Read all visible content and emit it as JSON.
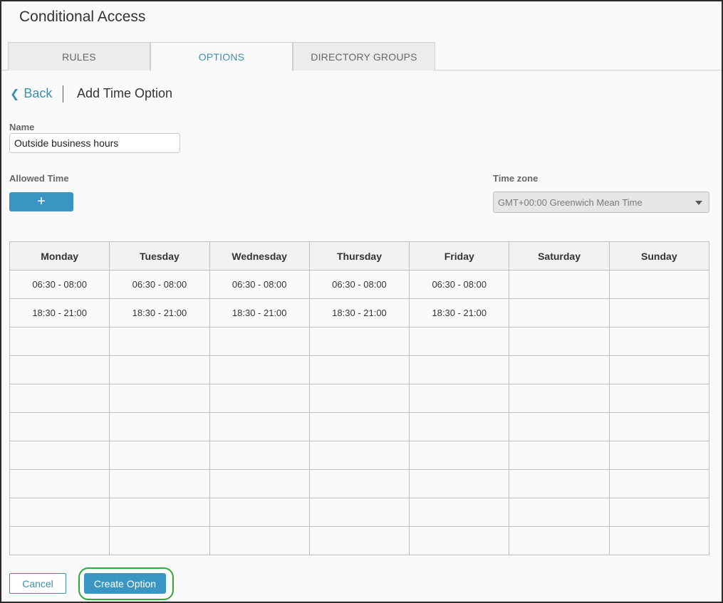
{
  "header": {
    "title": "Conditional Access"
  },
  "tabs": [
    {
      "label": "RULES"
    },
    {
      "label": "OPTIONS"
    },
    {
      "label": "DIRECTORY GROUPS"
    }
  ],
  "nav": {
    "back_label": "Back",
    "page_title": "Add Time Option"
  },
  "form": {
    "name_label": "Name",
    "name_value": "Outside business hours",
    "allowed_time_label": "Allowed Time",
    "add_button_label": "+",
    "timezone_label": "Time zone",
    "timezone_value": "GMT+00:00 Greenwich Mean Time"
  },
  "schedule": {
    "days": [
      "Monday",
      "Tuesday",
      "Wednesday",
      "Thursday",
      "Friday",
      "Saturday",
      "Sunday"
    ],
    "rows": [
      [
        "06:30 - 08:00",
        "06:30 - 08:00",
        "06:30 - 08:00",
        "06:30 - 08:00",
        "06:30 - 08:00",
        "",
        ""
      ],
      [
        "18:30 - 21:00",
        "18:30 - 21:00",
        "18:30 - 21:00",
        "18:30 - 21:00",
        "18:30 - 21:00",
        "",
        ""
      ],
      [
        "",
        "",
        "",
        "",
        "",
        "",
        ""
      ],
      [
        "",
        "",
        "",
        "",
        "",
        "",
        ""
      ],
      [
        "",
        "",
        "",
        "",
        "",
        "",
        ""
      ],
      [
        "",
        "",
        "",
        "",
        "",
        "",
        ""
      ],
      [
        "",
        "",
        "",
        "",
        "",
        "",
        ""
      ],
      [
        "",
        "",
        "",
        "",
        "",
        "",
        ""
      ],
      [
        "",
        "",
        "",
        "",
        "",
        "",
        ""
      ],
      [
        "",
        "",
        "",
        "",
        "",
        "",
        ""
      ]
    ]
  },
  "actions": {
    "cancel_label": "Cancel",
    "create_label": "Create Option"
  },
  "colors": {
    "accent": "#3a95c2",
    "highlight": "#2eaa3b"
  }
}
